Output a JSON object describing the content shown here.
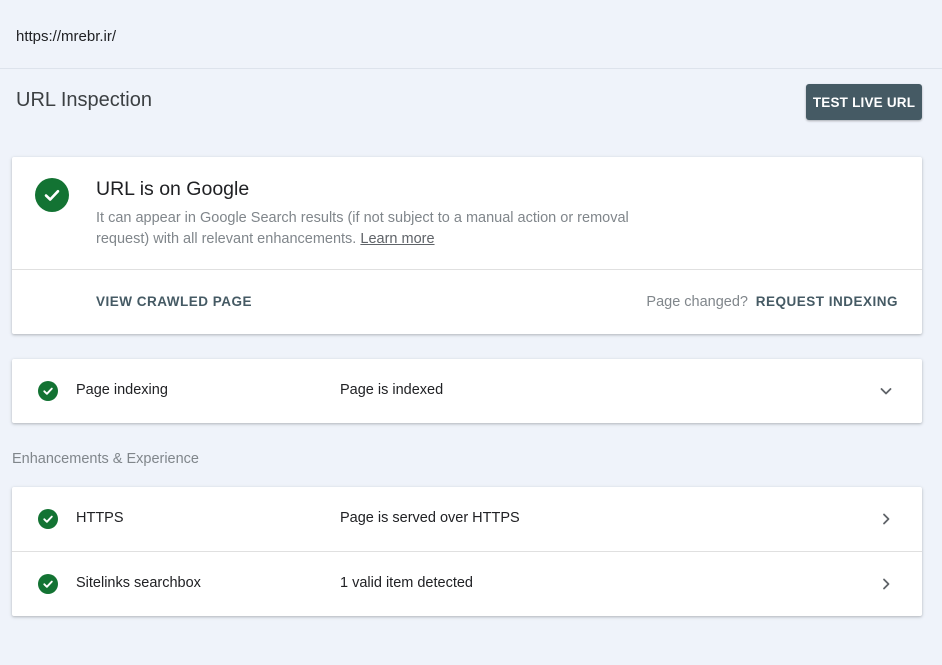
{
  "url_bar": {
    "url": "https://mrebr.ir/"
  },
  "header": {
    "title": "URL Inspection",
    "test_live_label": "TEST LIVE URL"
  },
  "status_card": {
    "title": "URL is on Google",
    "description": "It can appear in Google Search results (if not subject to a manual action or removal request) with all relevant enhancements.",
    "learn_more": "Learn more",
    "view_crawled_label": "VIEW CRAWLED PAGE",
    "page_changed_text": "Page changed?",
    "request_indexing_label": "REQUEST INDEXING",
    "status_icon": "check-circle-icon",
    "status_color": "#137333"
  },
  "indexing": {
    "label": "Page indexing",
    "value": "Page is indexed",
    "icon": "check-circle-icon",
    "action_icon": "chevron-down-icon"
  },
  "enhancements": {
    "heading": "Enhancements & Experience",
    "items": [
      {
        "label": "HTTPS",
        "value": "Page is served over HTTPS",
        "icon": "check-circle-icon",
        "action_icon": "chevron-right-icon"
      },
      {
        "label": "Sitelinks searchbox",
        "value": "1 valid item detected",
        "icon": "check-circle-icon",
        "action_icon": "chevron-right-icon"
      }
    ]
  },
  "colors": {
    "background": "#eff3fa",
    "primary_button": "#455a64",
    "success": "#137333",
    "muted_text": "#80868b"
  }
}
